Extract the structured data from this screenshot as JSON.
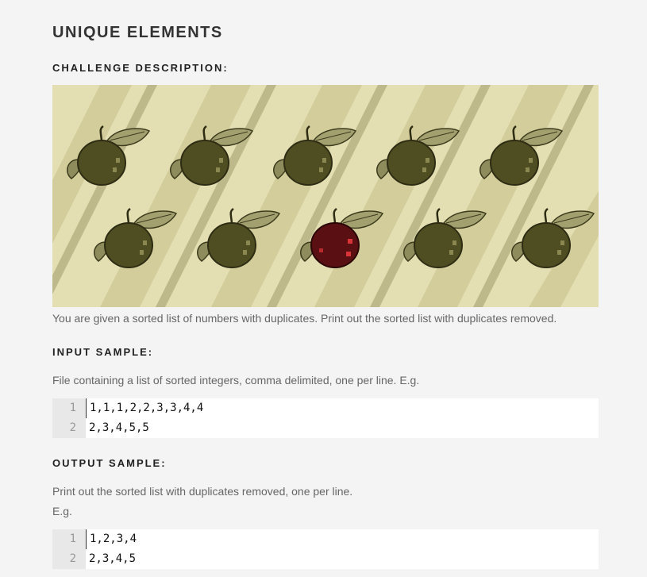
{
  "title": "UNIQUE ELEMENTS",
  "sections": {
    "challenge": {
      "heading": "CHALLENGE DESCRIPTION:"
    },
    "description": "You are given a sorted list of numbers with duplicates. Print out the sorted list with duplicates removed.",
    "input": {
      "heading": "INPUT SAMPLE:",
      "text": "File containing a list of sorted integers, comma delimited, one per line. E.g.",
      "code": [
        {
          "num": "1",
          "text": "1,1,1,2,2,3,3,4,4"
        },
        {
          "num": "2",
          "text": "2,3,4,5,5"
        }
      ]
    },
    "output": {
      "heading": "OUTPUT SAMPLE:",
      "text": "Print out the sorted list with duplicates removed, one per line.",
      "text2": "E.g.",
      "code": [
        {
          "num": "1",
          "text": "1,2,3,4"
        },
        {
          "num": "2",
          "text": "2,3,4,5"
        }
      ]
    }
  },
  "colors": {
    "page_bg": "#f4f4f4",
    "hero_bg": "#e3dfb3",
    "apple": "#4f4e22",
    "apple_red": "#5a1012",
    "leaf": "#9c9a6a"
  }
}
